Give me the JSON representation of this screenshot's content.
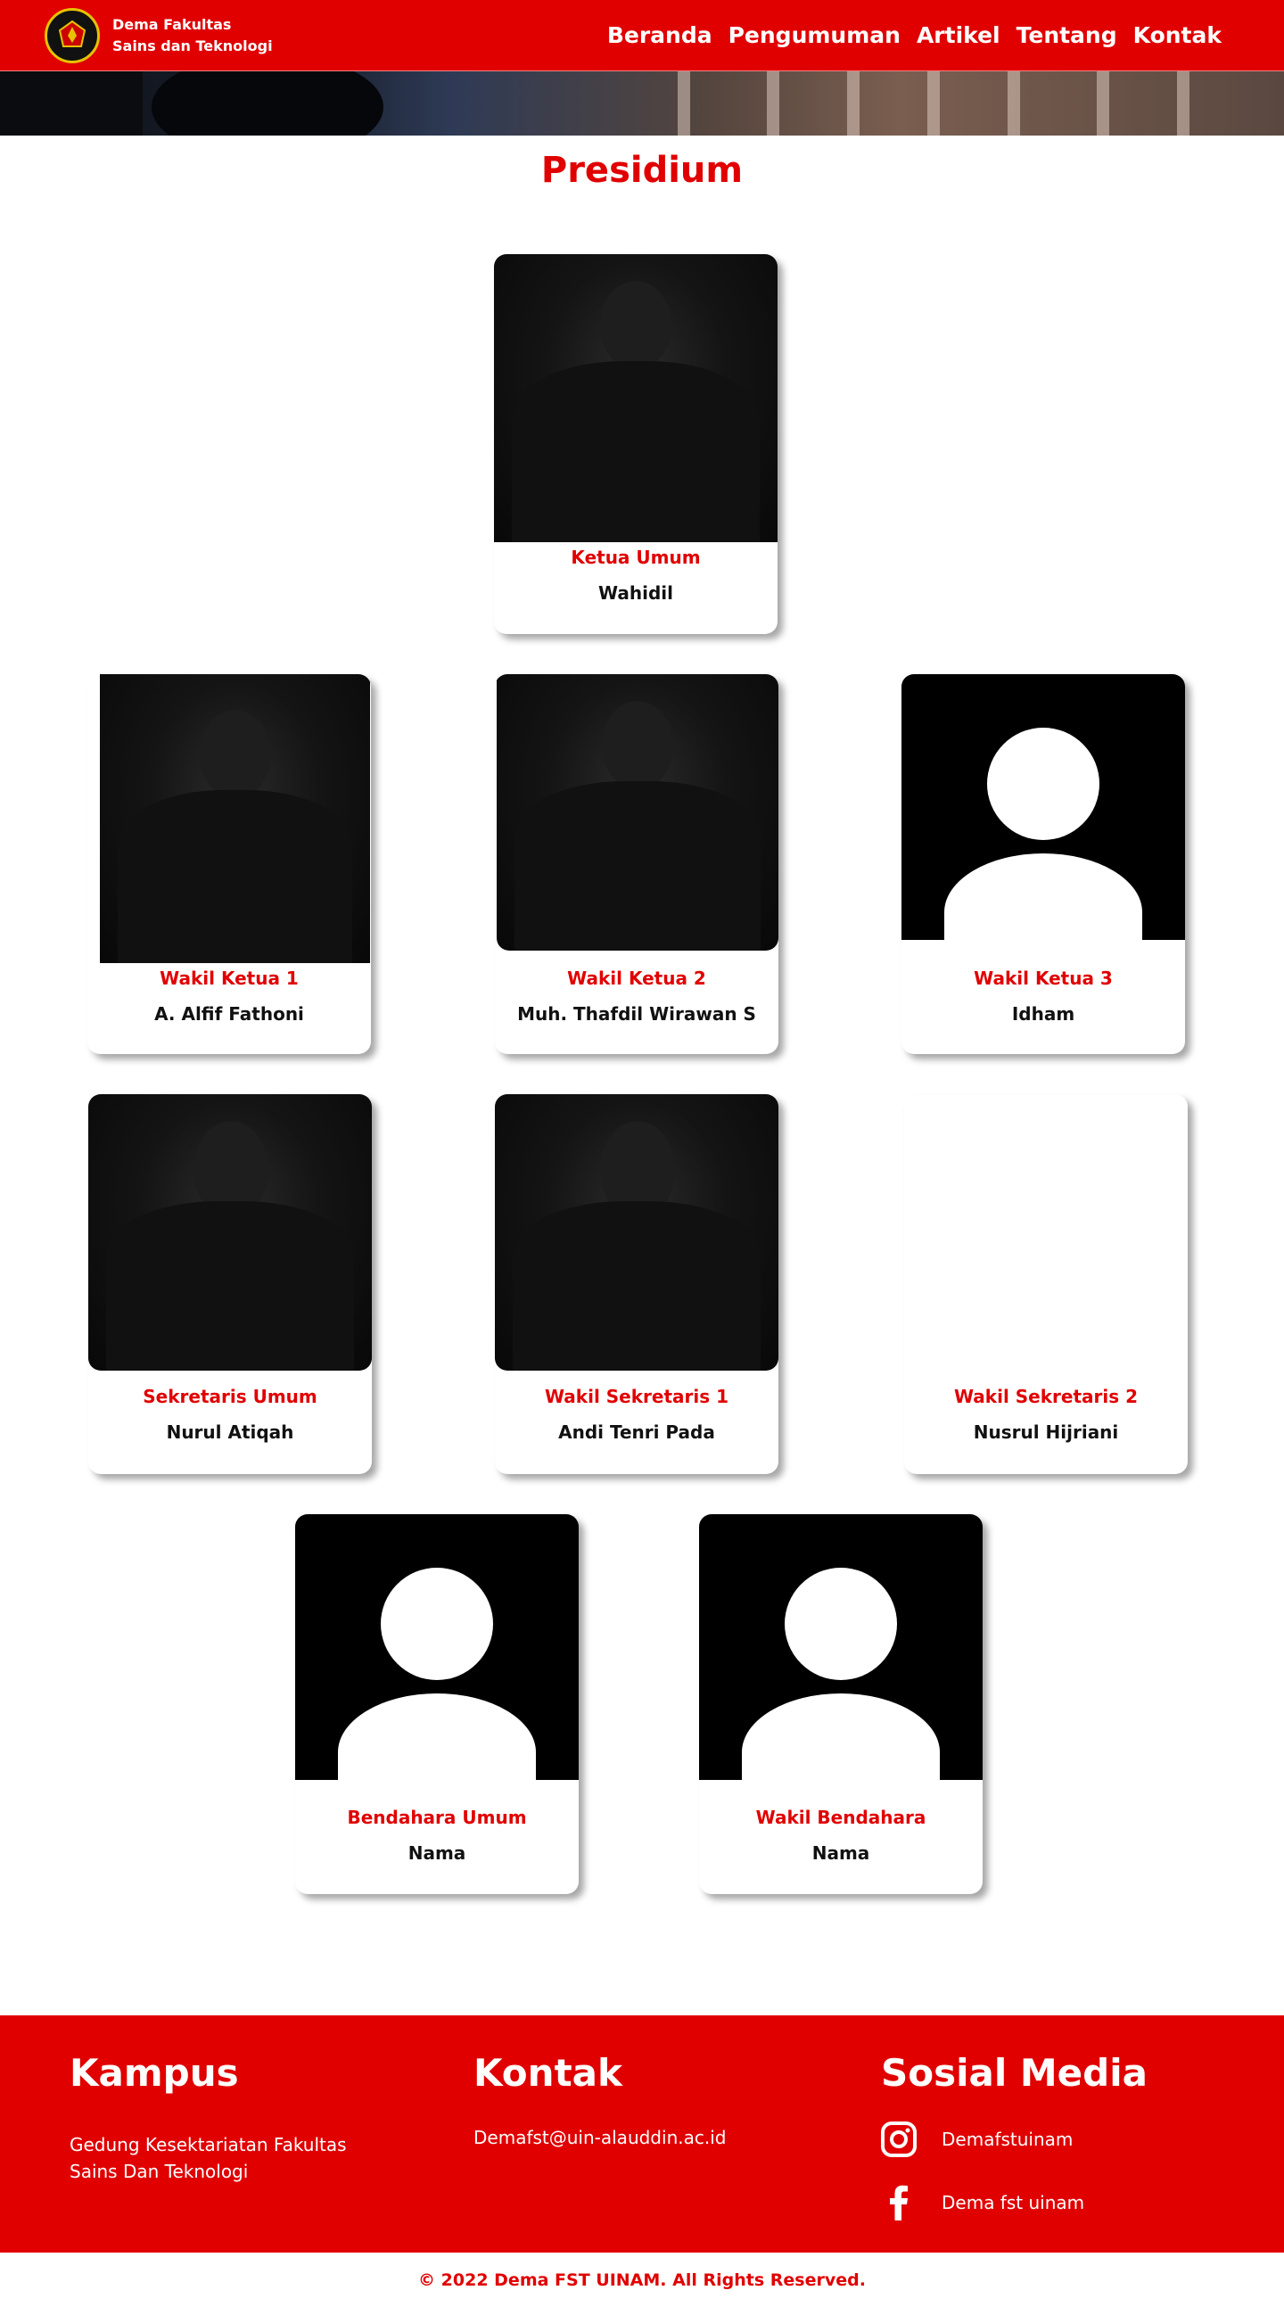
{
  "brand": {
    "line1": "Dema Fakultas",
    "line2": "Sains dan Teknologi",
    "logo_icon": "dema-logo-icon"
  },
  "nav": [
    "Beranda",
    "Pengumuman",
    "Artikel",
    "Tentang",
    "Kontak"
  ],
  "section_title": "Presidium",
  "members": [
    {
      "role": "Ketua Umum",
      "name": "Wahidil",
      "photo": "photo"
    },
    {
      "role": "Wakil Ketua 1",
      "name": "A. Alfif Fathoni",
      "photo": "photo"
    },
    {
      "role": "Wakil Ketua 2",
      "name": "Muh. Thafdil Wirawan S",
      "photo": "photo"
    },
    {
      "role": "Wakil Ketua 3",
      "name": "Idham",
      "photo": "avatar-placeholder"
    },
    {
      "role": "Sekretaris Umum",
      "name": "Nurul Atiqah",
      "photo": "photo"
    },
    {
      "role": "Wakil Sekretaris 1",
      "name": "Andi Tenri Pada",
      "photo": "photo"
    },
    {
      "role": "Wakil Sekretaris 2",
      "name": "Nusrul Hijriani",
      "photo": "none"
    },
    {
      "role": "Bendahara Umum",
      "name": "Nama",
      "photo": "avatar-placeholder"
    },
    {
      "role": "Wakil Bendahara",
      "name": "Nama",
      "photo": "avatar-placeholder"
    }
  ],
  "footer": {
    "kampus": {
      "title": "Kampus",
      "line1": "Gedung Kesektariatan Fakultas",
      "line2": "Sains Dan Teknologi"
    },
    "kontak": {
      "title": "Kontak",
      "email": "Demafst@uin-alauddin.ac.id"
    },
    "sosmed": {
      "title": "Sosial Media",
      "instagram": {
        "icon": "instagram-icon",
        "label": "Demafstuinam"
      },
      "facebook": {
        "icon": "facebook-icon",
        "label": "Dema fst uinam"
      }
    }
  },
  "copyright": "© 2022 Dema FST UINAM. All Rights Reserved.",
  "colors": {
    "primary": "#e10000",
    "text": "#111111",
    "white": "#ffffff"
  }
}
